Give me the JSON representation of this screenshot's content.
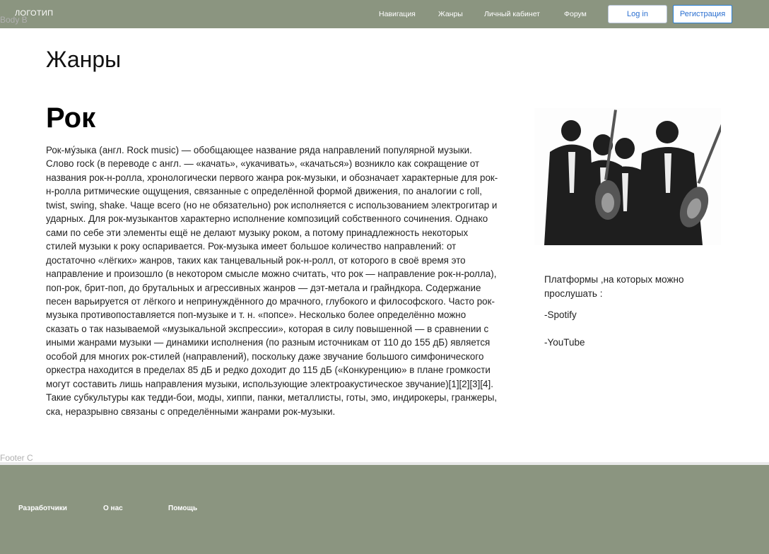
{
  "header": {
    "logo": "ЛОГОТИП",
    "nav": [
      "Навигация",
      "Жанры",
      "Личный кабинет",
      "Форум"
    ],
    "login_label": "Log in",
    "register_label": "Регистрация"
  },
  "frame_labels": {
    "body": "Body B",
    "footer": "Footer C"
  },
  "main": {
    "page_title": "Жанры",
    "genre_title": "Рок",
    "genre_text": "Рок-му́зыка (англ. Rock music) — обобщающее название ряда направлений популярной музыки. Слово rock (в переводе с англ. — «качать», «укачивать», «качаться») возникло как сокращение от названия рок-н-ролла, хронологически первого жанра рок-музыки, и обозначает характерные для рок-н-ролла ритмические ощущения, связанные с определённой формой движения, по аналогии с roll, twist, swing, shake. Чаще всего (но не обязательно) рок исполняется с использованием электрогитар и ударных. Для рок-музыкантов характерно исполнение композиций собственного сочинения. Однако сами по себе эти элементы ещё не делают музыку роком, а потому принадлежность некоторых стилей музыки к року оспаривается. Рок-музыка имеет большое количество направлений: от достаточно «лёгких» жанров, таких как танцевальный рок-н-ролл, от которого в своё время это направление и произошло (в некотором смысле можно считать, что рок — направление рок-н-ролла), поп-рок, брит-поп, до брутальных и агрессивных жанров — дэт-метала и грайндкора. Содержание песен варьируется от лёгкого и непринуждённого до мрачного, глубокого и философского. Часто рок-музыка противопоставляется поп-музыке и т. н. «попсе». Несколько более определённо можно сказать о так называемой «музыкальной экспрессии», которая в силу повышенной — в сравнении с иными жанрами музыки — динамики исполнения (по разным источникам от 110 до 155 дБ) является особой для многих рок-стилей (направлений), поскольку даже звучание большого симфонического оркестра находится в пределах 85 дБ и редко доходит до 115 дБ («Конкуренцию» в плане громкости могут составить лишь направления музыки, использующие электроакустическое звучание)[1][2][3][4]. Такие субкультуры как тедди-бои, моды, хиппи, панки, металлисты, готы, эмо, индирокеры, гранжеры, ска, неразрывно связаны с определёнными жанрами рок-музыки."
  },
  "aside": {
    "platforms_title": "Платформы ,на которых можно прослушать :",
    "platforms": [
      "-Spotify",
      "-YouTube"
    ]
  },
  "footer": {
    "links": [
      "Разработчики",
      "О нас",
      "Помощь"
    ]
  }
}
